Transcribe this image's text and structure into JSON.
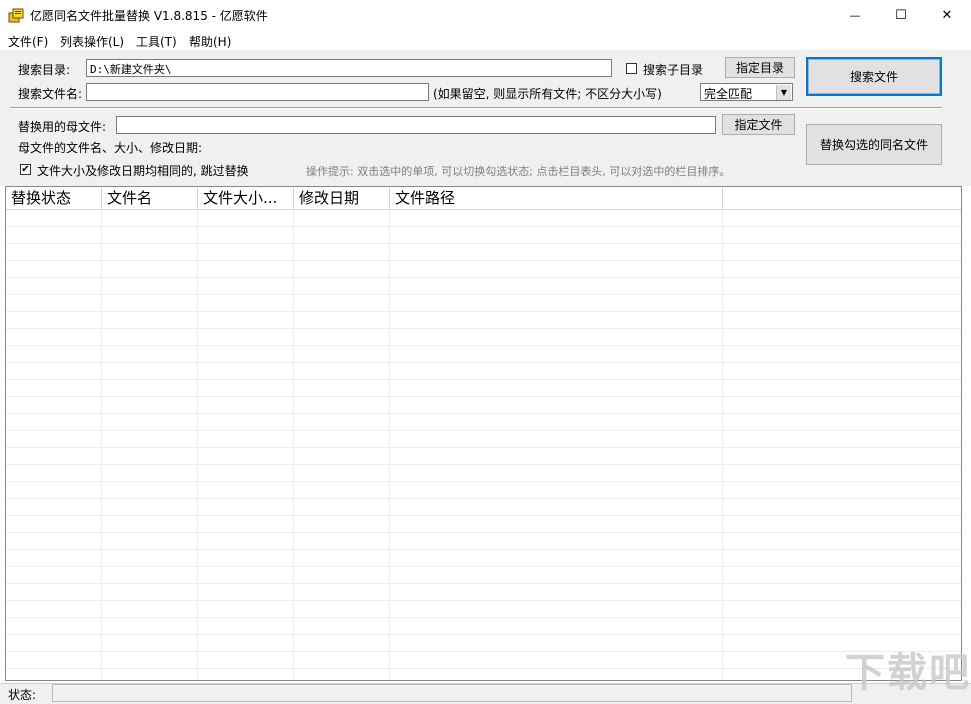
{
  "window": {
    "title": "亿愿同名文件批量替换 V1.8.815 - 亿愿软件",
    "icon": "app-icon",
    "minimize_glyph": "—",
    "maximize_glyph": "☐",
    "close_glyph": "✕"
  },
  "menu": {
    "items": [
      {
        "label": "文件(F)"
      },
      {
        "label": "列表操作(L)"
      },
      {
        "label": "工具(T)"
      },
      {
        "label": "帮助(H)"
      }
    ]
  },
  "search": {
    "dir_label": "搜索目录:",
    "dir_value": "D:\\新建文件夹\\",
    "subdir_label": "搜索子目录",
    "subdir_checked": false,
    "choose_dir_button": "指定目录",
    "search_button": "搜索文件",
    "filename_label": "搜索文件名:",
    "filename_value": "",
    "filename_hint": "(如果留空, 则显示所有文件; 不区分大小写)",
    "match_mode": "完全匹配"
  },
  "replace": {
    "source_label": "替换用的母文件:",
    "source_value": "",
    "choose_file_button": "指定文件",
    "info_label": "母文件的文件名、大小、修改日期:",
    "replace_button": "替换勾选的同名文件",
    "skip_label": "文件大小及修改日期均相同的, 跳过替换",
    "skip_checked": true,
    "tip": "操作提示: 双击选中的单项, 可以切换勾选状态; 点击栏目表头, 可以对选中的栏目排序。"
  },
  "list": {
    "columns": [
      {
        "label": "替换状态"
      },
      {
        "label": "文件名"
      },
      {
        "label": "文件大小..."
      },
      {
        "label": "修改日期"
      },
      {
        "label": "文件路径"
      }
    ],
    "rows": []
  },
  "status": {
    "label": "状态:",
    "value": ""
  },
  "watermark": "下载吧"
}
